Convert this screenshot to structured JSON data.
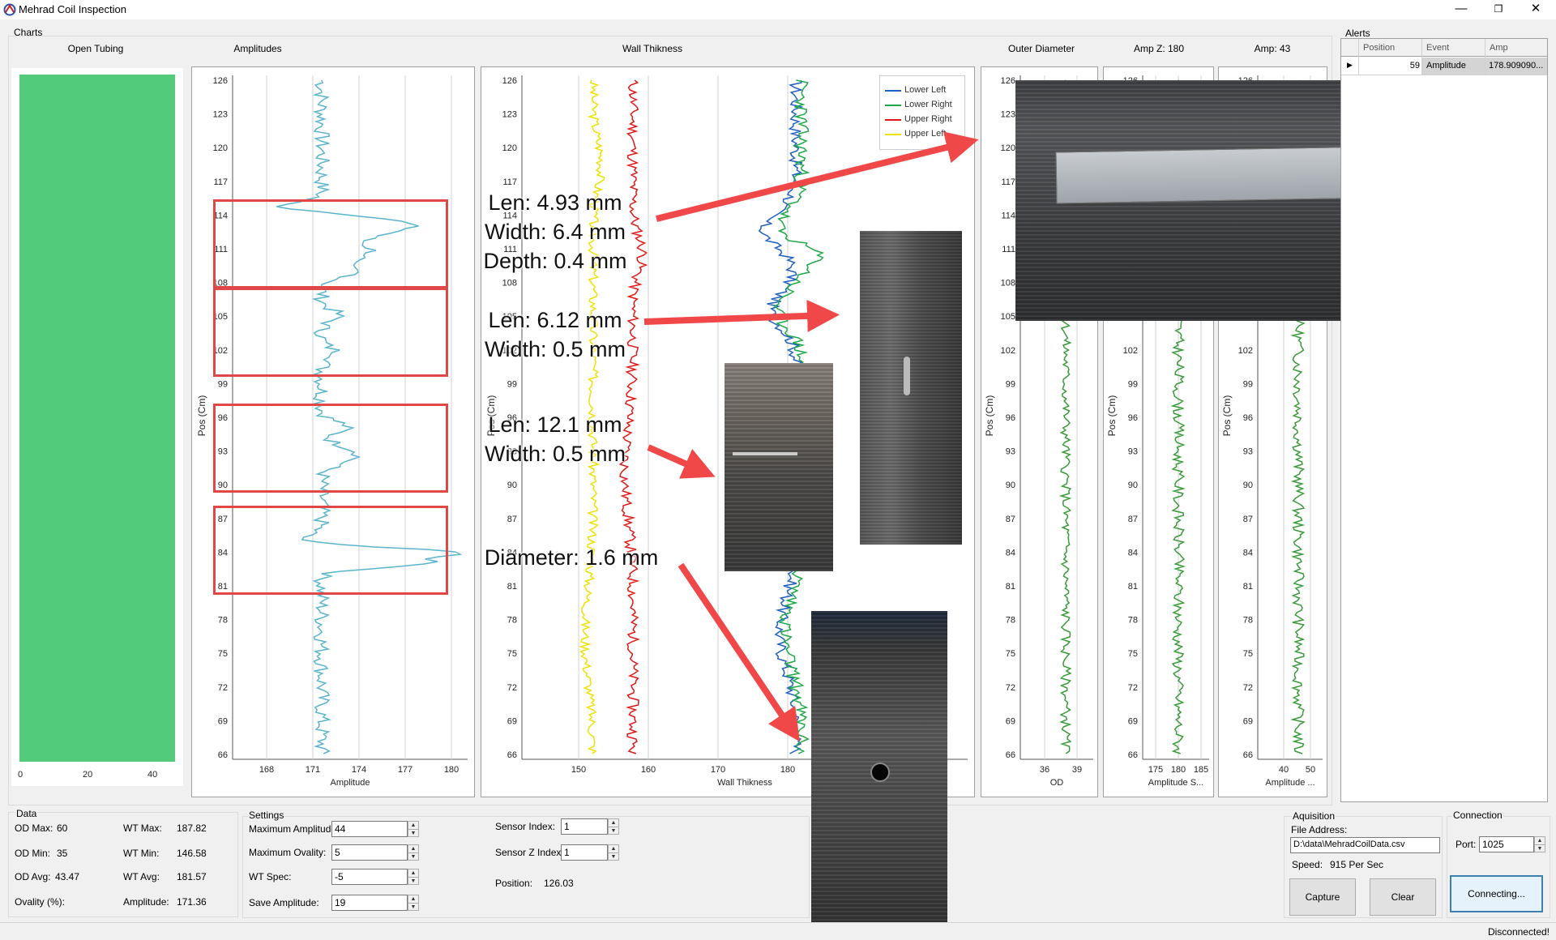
{
  "window": {
    "title": "Mehrad Coil Inspection",
    "minimize": "—",
    "restore": "❐",
    "close": "✕"
  },
  "charts_group": "Charts",
  "chart_titles": {
    "open": "Open Tubing",
    "amp": "Amplitudes",
    "wall": "Wall Thikness",
    "od": "Outer Diameter",
    "ampz": "Amp Z: 180",
    "amp43": "Amp: 43"
  },
  "open_tubing": {
    "ticks": [
      "0",
      "20",
      "40"
    ],
    "color": "#52cc7a"
  },
  "y_ticks": [
    "126",
    "123",
    "120",
    "117",
    "114",
    "111",
    "108",
    "105",
    "102",
    "99",
    "96",
    "93",
    "90",
    "87",
    "84",
    "81",
    "78",
    "75",
    "72",
    "69",
    "66"
  ],
  "amp_chart": {
    "x_ticks": [
      "168",
      "171",
      "174",
      "177",
      "180"
    ],
    "xlabel": "Amplitude",
    "ylabel": "Pos (Cm)"
  },
  "wall_chart": {
    "x_ticks": [
      "150",
      "160",
      "170",
      "180"
    ],
    "xlabel": "Wall Thikness",
    "ylabel": "Pos (Cm)"
  },
  "od_chart": {
    "x_ticks": [
      "36",
      "39"
    ],
    "xlabel": "OD",
    "ylabel": "Pos (Cm)"
  },
  "ampz_chart": {
    "x_ticks": [
      "175",
      "180",
      "185"
    ],
    "xlabel": "Amplitude S...",
    "ylabel": "Pos (Cm)"
  },
  "amp43_chart": {
    "x_ticks": [
      "40",
      "50"
    ],
    "xlabel": "Amplitude ...",
    "ylabel": "Pos (Cm)"
  },
  "legend": [
    {
      "name": "Lower Left",
      "color": "#1f5fbf"
    },
    {
      "name": "Lower Right",
      "color": "#1fa84a"
    },
    {
      "name": "Upper Right",
      "color": "#e01818"
    },
    {
      "name": "Upper Left",
      "color": "#f0e000"
    }
  ],
  "colors": {
    "amp": "#5ab4cc",
    "od": "#3a9a3a",
    "red_box": "#e04848",
    "arrow": "#f04848"
  },
  "callouts": {
    "c1": [
      "Len: 4.93 mm",
      "Width: 6.4 mm",
      "Depth: 0.4 mm"
    ],
    "c2": [
      "Len: 6.12 mm",
      "Width: 0.5 mm"
    ],
    "c3": [
      "Len: 12.1 mm",
      "Width: 0.5 mm"
    ],
    "c4": [
      "Diameter: 1.6 mm"
    ]
  },
  "alerts": {
    "group": "Alerts",
    "columns": [
      "Position",
      "Event",
      "Amp"
    ],
    "rows": [
      {
        "position": "59",
        "event": "Amplitude",
        "amp": "178.909090..."
      }
    ]
  },
  "data_group": {
    "title": "Data",
    "od_max_label": "OD Max:",
    "od_max": "60",
    "od_min_label": "OD Min:",
    "od_min": "35",
    "od_avg_label": "OD Avg:",
    "od_avg": "43.47",
    "ovality_label": "Ovality (%):",
    "ovality": "",
    "wt_max_label": "WT Max:",
    "wt_max": "187.82",
    "wt_min_label": "WT Min:",
    "wt_min": "146.58",
    "wt_avg_label": "WT Avg:",
    "wt_avg": "181.57",
    "amplitude_label": "Amplitude:",
    "amplitude": "171.36"
  },
  "settings": {
    "title": "Settings",
    "max_amp_label": "Maximum Amplitude:",
    "max_amp": "44",
    "max_ovality_label": "Maximum Ovality:",
    "max_ovality": "5",
    "wt_spec_label": "WT Spec:",
    "wt_spec": "-5",
    "save_amp_label": "Save Amplitude:",
    "save_amp": "19",
    "sensor_index_label": "Sensor Index:",
    "sensor_index": "1",
    "sensor_z_label": "Sensor Z Index:",
    "sensor_z": "1",
    "position_label": "Position:",
    "position": "126.03"
  },
  "acquisition": {
    "title": "Aquisition",
    "file_label": "File Address:",
    "file": "D:\\data\\MehradCoilData.csv",
    "speed_label": "Speed:",
    "speed": "915 Per Sec",
    "capture": "Capture",
    "clear": "Clear"
  },
  "connection": {
    "title": "Connection",
    "port_label": "Port:",
    "port": "1025",
    "connect": "Connecting..."
  },
  "status": "Disconnected!"
}
